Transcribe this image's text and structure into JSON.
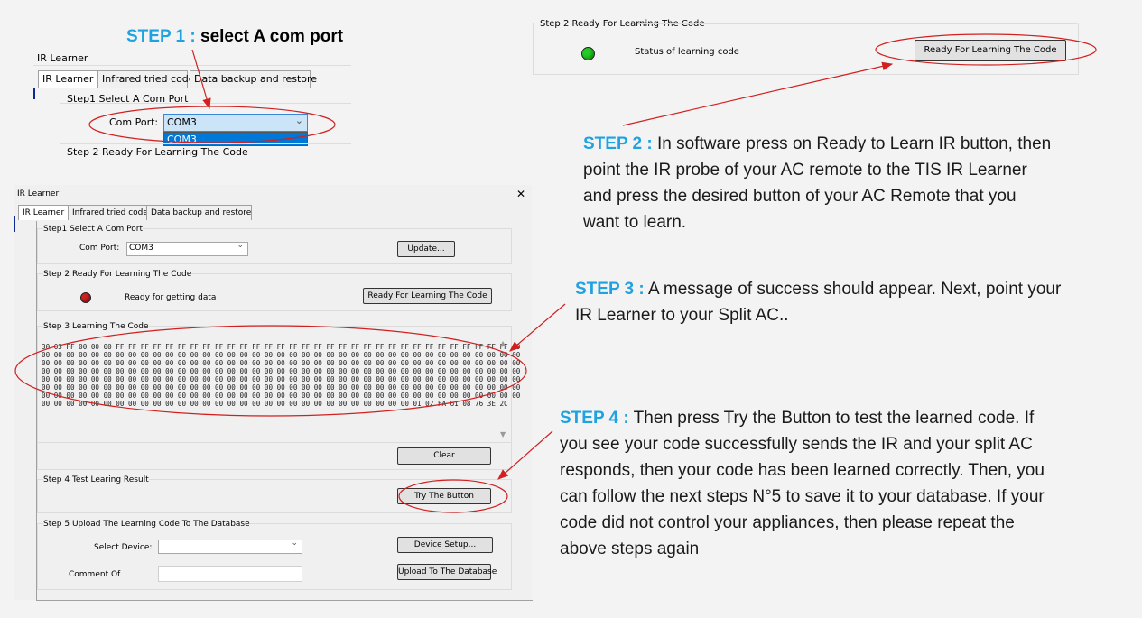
{
  "step1": {
    "label": "STEP 1 :",
    "text": "select A com port"
  },
  "step2": {
    "label": "STEP 2 :",
    "lines": [
      "In software press on Ready to Learn IR button, then",
      "point the IR probe of your AC remote to the TIS IR Learner",
      "and press the desired button of your AC Remote that you",
      "want to learn."
    ]
  },
  "step3": {
    "label": "STEP 3  :",
    "lines": [
      "A message of success should appear. Next, point your",
      "IR Learner to your Split AC.."
    ]
  },
  "step4": {
    "label": "STEP 4  :",
    "lines": [
      "Then press Try the Button to test the learned code. If",
      "you see your code successfully sends the IR and your split AC",
      "responds, then your code has been learned correctly. Then, you",
      "can follow the next steps N°5 to save it to your database. If your",
      "code did not control your appliances, then please repeat the",
      "above steps again"
    ]
  },
  "app": {
    "title": "IR Learner",
    "close_glyph": "✕",
    "tabs": [
      "IR Learner",
      "Infrared tried code",
      "Data backup and restore"
    ]
  },
  "panel1": {
    "group1_title": "Step1 Select A Com Port",
    "com_port_label": "Com Port:",
    "com_port_value": "COM3",
    "dropdown_option": "COM3",
    "group2_title": "Step 2 Ready For Learning The Code"
  },
  "panel2": {
    "group_title": "Step 2 Ready For Learning The Code",
    "status_label": "Status of learning code",
    "status_color": "#22cc22",
    "button_label": "Ready For Learning The Code"
  },
  "main": {
    "group1": {
      "title": "Step1 Select A Com Port",
      "com_port_label": "Com Port:",
      "com_port_value": "COM3",
      "update_button": "Update..."
    },
    "group2": {
      "title": "Step 2 Ready For Learning The Code",
      "status_text": "Ready for getting data",
      "status_color": "#d61f1f",
      "button_label": "Ready For Learning The Code"
    },
    "group3": {
      "title": "Step 3 Learning The Code",
      "code_lines": [
        "30 03 FF 00 00 00 FF FF FF FF FF FF FF FF FF FF FF FF FF FF FF FF FF FF FF FF FF FF FF FF FF FF FF FF FF FF FF FF 00",
        "00 00 00 00 00 00 00 00 00 00 00 00 00 00 00 00 00 00 00 00 00 00 00 00 00 00 00 00 00 00 00 00 00 00 00 00 00 00 00",
        "00 00 00 00 00 00 00 00 00 00 00 00 00 00 00 00 00 00 00 00 00 00 00 00 00 00 00 00 00 00 00 00 00 00 00 00 00 00 00",
        "00 00 00 00 00 00 00 00 00 00 00 00 00 00 00 00 00 00 00 00 00 00 00 00 00 00 00 00 00 00 00 00 00 00 00 00 00 00 00",
        "00 00 00 00 00 00 00 00 00 00 00 00 00 00 00 00 00 00 00 00 00 00 00 00 00 00 00 00 00 00 00 00 00 00 00 00 00 00 00",
        "00 00 00 00 00 00 00 00 00 00 00 00 00 00 00 00 00 00 00 00 00 00 00 00 00 00 00 00 00 00 00 00 00 00 00 00 00 00 00",
        "00 00 00 00 00 00 00 00 00 00 00 00 00 00 00 00 00 00 00 00 00 00 00 00 00 00 00 00 00 00 00 00 00 00 00 00 00 00 00",
        "00 00 00 00 00 00 00 00 00 00 00 00 00 00 00 00 00 00 00 00 00 00 00 00 00 00 00 00 00 00 01 02 FA 61 08 76 3E 2C"
      ],
      "clear_button": "Clear"
    },
    "group4": {
      "title": "Step 4 Test Learing Result",
      "try_button": "Try The Button"
    },
    "group5": {
      "title": "Step 5 Upload The Learning Code To The Database",
      "select_device_label": "Select Device:",
      "select_device_value": "",
      "device_setup_button": "Device Setup...",
      "comment_label": "Comment Of",
      "comment_value": "",
      "upload_button": "Upload To The Database"
    }
  }
}
